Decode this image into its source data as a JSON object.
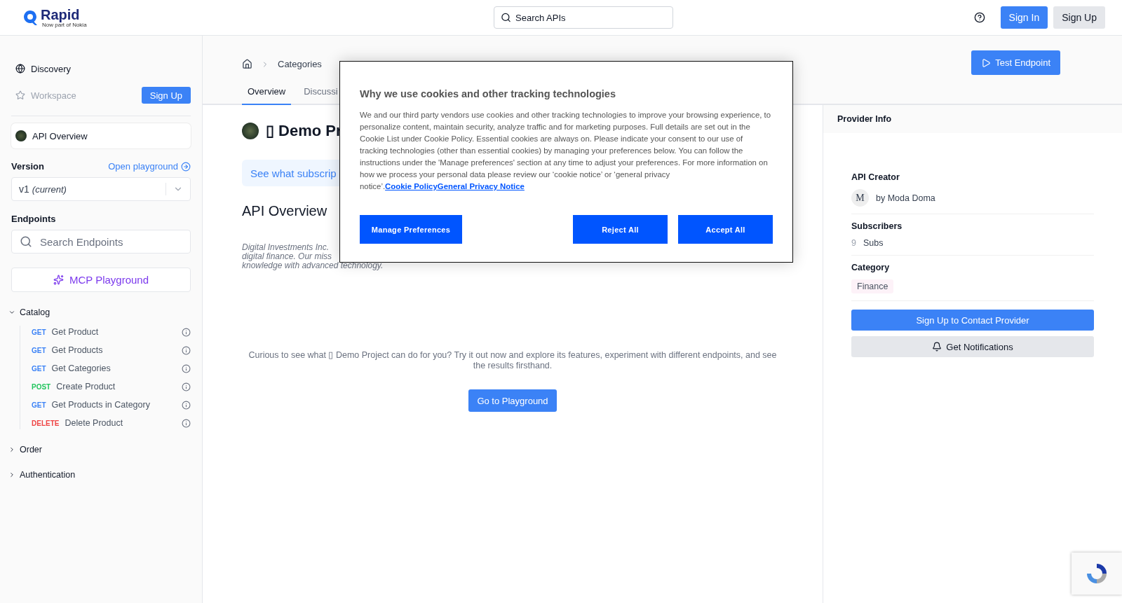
{
  "header": {
    "logo": {
      "name": "Rapid",
      "tagline": "Now part of Nokia"
    },
    "search": {
      "placeholder": "Search APIs"
    },
    "buttons": [
      {
        "label": "Sign In",
        "kind": "primary"
      },
      {
        "label": "Sign Up",
        "kind": "secondary"
      }
    ]
  },
  "sidebar": {
    "nav": [
      {
        "label": "Discovery",
        "kind": "discovery",
        "disabled": false
      },
      {
        "label": "Workspace",
        "kind": "workspace",
        "disabled": true
      }
    ],
    "signup_button": "Sign Up",
    "overview_item": {
      "label": "API Overview",
      "selected": true
    },
    "version": {
      "label": "Version",
      "link": "Open playground",
      "value": "v1",
      "note": "(current)"
    },
    "endpoints": {
      "label": "Endpoints",
      "placeholder": "Search Endpoints"
    },
    "mcp_button": "MCP Playground",
    "groups": [
      {
        "name": "Catalog",
        "expanded": true,
        "children": [
          {
            "method": "GET",
            "name": "Get Product",
            "color": "#3b82f6"
          },
          {
            "method": "GET",
            "name": "Get Products",
            "color": "#3b82f6"
          },
          {
            "method": "GET",
            "name": "Get Categories",
            "color": "#3b82f6"
          },
          {
            "method": "POST",
            "name": "Create Product",
            "color": "#22c55e"
          },
          {
            "method": "GET",
            "name": "Get Products in Category",
            "color": "#3b82f6"
          },
          {
            "method": "DELETE",
            "name": "Delete Product",
            "color": "#ef4444"
          }
        ]
      },
      {
        "name": "Order",
        "expanded": false
      },
      {
        "name": "Authentication",
        "expanded": false
      }
    ]
  },
  "main": {
    "breadcrumb": [
      "Categories"
    ],
    "tabs": [
      {
        "label": "Overview",
        "selected": true
      },
      {
        "label": "Discussi",
        "selected": false
      }
    ],
    "test_button": "Test Endpoint",
    "title": "▯ Demo Pr",
    "subscription_banner": "See what subscrip",
    "section_title": "API Overview",
    "description_lines": [
      "Digital Investments Inc.",
      "digital finance. Our miss",
      "knowledge with advanced technology."
    ],
    "playground_text": "Curious to see what ▯ Demo Project can do for you? Try it out now and explore its features, experiment with different endpoints, and see the results firsthand.",
    "playground_button": "Go to Playground"
  },
  "provider": {
    "title": "Provider Info",
    "creator_label": "API Creator",
    "creator_initial": "M",
    "creator_name": "by Moda Doma",
    "subscribers_label": "Subscribers",
    "subscribers_count": "9",
    "subscribers_unit": "Subs",
    "category_label": "Category",
    "category": "Finance",
    "contact_button": "Sign Up to Contact Provider",
    "notify_button": "Get Notifications"
  },
  "cookie_dialog": {
    "title": "Why we use cookies and other tracking technologies",
    "body": "We and our third party vendors use cookies and other tracking technologies to improve your browsing experience, to personalize content, maintain security, analyze traffic and for marketing purposes. Full details are set out in the Cookie List under Cookie Policy. Essential cookies are always on. Please indicate your consent to our use of tracking technologies (other than essential cookies) by managing your preferences below. You can follow the instructions under the 'Manage preferences' section at any time to adjust your preferences. For more information on how we process your personal data please review our ‘cookie notice’ or ‘general privacy notice’.",
    "links": [
      "Cookie Policy",
      "General Privacy Notice"
    ],
    "buttons": [
      {
        "label": "Manage Preferences",
        "kind": "left"
      },
      {
        "label": "Reject All",
        "kind": "right"
      },
      {
        "label": "Accept All",
        "kind": "right"
      }
    ]
  }
}
